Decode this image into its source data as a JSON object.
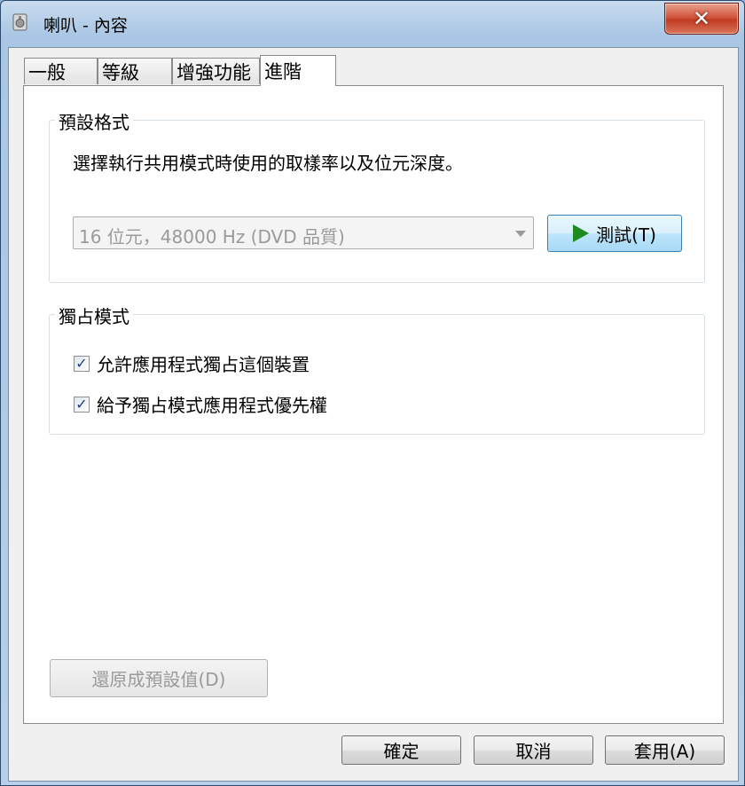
{
  "window": {
    "title": "喇叭 - 內容",
    "close_glyph": "✕"
  },
  "tabs": [
    {
      "label": "一般"
    },
    {
      "label": "等級"
    },
    {
      "label": "增強功能"
    },
    {
      "label": "進階"
    }
  ],
  "default_format": {
    "group_label": "預設格式",
    "description": "選擇執行共用模式時使用的取樣率以及位元深度。",
    "selected_value": "16 位元，48000 Hz (DVD 品質)",
    "test_button_label": "測試(T)"
  },
  "exclusive_mode": {
    "group_label": "獨占模式",
    "options": [
      {
        "label": "允許應用程式獨占這個裝置",
        "checked": true
      },
      {
        "label": "給予獨占模式應用程式優先權",
        "checked": true
      }
    ]
  },
  "restore_defaults_label": "還原成預設值(D)",
  "footer": {
    "ok_label": "確定",
    "cancel_label": "取消",
    "apply_label": "套用(A)"
  }
}
